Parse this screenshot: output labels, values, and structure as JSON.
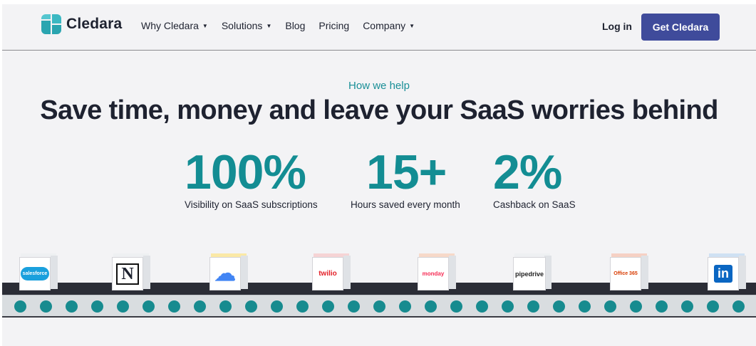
{
  "header": {
    "logo_text": "Cledara",
    "nav": [
      {
        "label": "Why Cledara",
        "caret": "▼"
      },
      {
        "label": "Solutions",
        "caret": "▼"
      },
      {
        "label": "Blog",
        "caret": ""
      },
      {
        "label": "Pricing",
        "caret": ""
      },
      {
        "label": "Company",
        "caret": "▼"
      }
    ],
    "login_label": "Log in",
    "cta_label": "Get Cledara"
  },
  "hero": {
    "eyebrow": "How we help",
    "headline": "Save time, money and leave your SaaS worries behind",
    "stats": [
      {
        "value": "100%",
        "label": "Visibility on SaaS subscriptions"
      },
      {
        "value": "15+",
        "label": "Hours saved every month"
      },
      {
        "value": "2%",
        "label": "Cashback on SaaS"
      }
    ]
  },
  "conveyor": {
    "brands": [
      {
        "name": "salesforce",
        "text": "salesforce",
        "color": "#1aa0dd",
        "icon": "salesforce-icon"
      },
      {
        "name": "notion",
        "text": "N",
        "color": "#111111",
        "icon": "notion-icon"
      },
      {
        "name": "google-cloud",
        "text": "☁",
        "color": "#4285f4",
        "icon": "google-cloud-icon"
      },
      {
        "name": "twilio",
        "text": "twilio",
        "color": "#e31e26",
        "icon": "twilio-icon"
      },
      {
        "name": "monday",
        "text": "monday",
        "color": "#f62b54",
        "icon": "monday-icon"
      },
      {
        "name": "pipedrive",
        "text": "pipedrive",
        "color": "#222222",
        "icon": "pipedrive-icon"
      },
      {
        "name": "office-365",
        "text": "Office 365",
        "color": "#d83b01",
        "icon": "office-365-icon"
      },
      {
        "name": "linkedin",
        "text": "in",
        "color": "#0a66c2",
        "icon": "linkedin-icon"
      }
    ]
  },
  "colors": {
    "accent": "#138d93",
    "cta": "#3f4b9b",
    "text": "#1e2230",
    "background": "#f3f3f5"
  }
}
